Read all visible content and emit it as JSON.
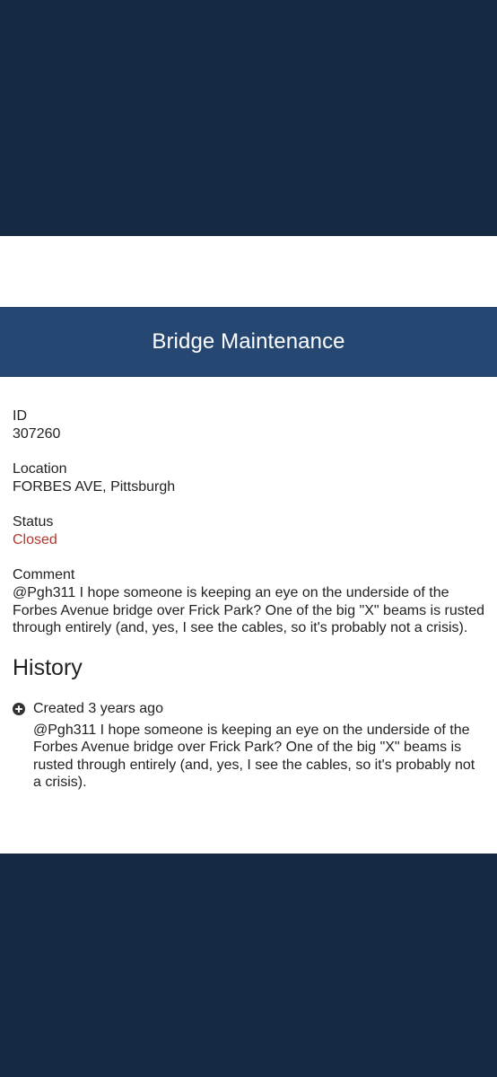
{
  "header": {
    "title": "Bridge Maintenance"
  },
  "details": {
    "id_label": "ID",
    "id_value": "307260",
    "location_label": "Location",
    "location_value": "FORBES AVE, Pittsburgh",
    "status_label": "Status",
    "status_value": "Closed",
    "comment_label": "Comment",
    "comment_value": "@Pgh311 I hope someone is keeping an eye on the underside of the Forbes Avenue bridge over Frick Park? One of the big \"X\" beams is rusted through entirely (and, yes, I see the cables, so it's probably not a crisis)."
  },
  "history": {
    "title": "History",
    "entries": [
      {
        "icon": "plus-circle-icon",
        "heading": "Created 3 years ago",
        "body": "@Pgh311 I hope someone is keeping an eye on the underside of the Forbes Avenue bridge over Frick Park? One of the big \"X\" beams is rusted through entirely (and, yes, I see the cables, so it's probably not a crisis)."
      }
    ]
  },
  "colors": {
    "background_dark": "#152943",
    "header_bar": "#254772",
    "status_closed": "#b3372c",
    "text": "#222222"
  }
}
